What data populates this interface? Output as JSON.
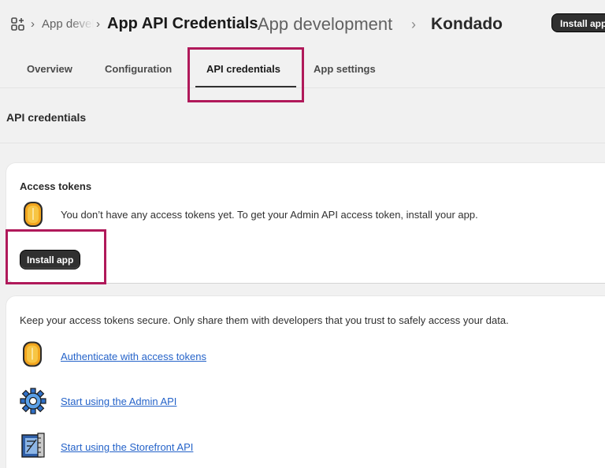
{
  "header": {
    "crumb_small": "App development",
    "crumb_bold": "App API Credentials",
    "crumb_light": "App development",
    "shop": "Kondado",
    "install_label": "Install app"
  },
  "tabs": [
    {
      "label": "Overview"
    },
    {
      "label": "Configuration"
    },
    {
      "label": "API credentials"
    },
    {
      "label": "App settings"
    }
  ],
  "section": {
    "title": "API credentials"
  },
  "access_tokens": {
    "title": "Access tokens",
    "message": "You don’t have any access tokens yet. To get your Admin API access token, install your app.",
    "install_label": "Install app"
  },
  "security": {
    "message": "Keep your access tokens secure. Only share them with developers that you trust to safely access your data.",
    "links": [
      {
        "label": "Authenticate with access tokens",
        "icon": "coin-icon"
      },
      {
        "label": "Start using the Admin API",
        "icon": "gear-icon"
      },
      {
        "label": "Start using the Storefront API",
        "icon": "blueprint-icon"
      }
    ]
  },
  "colors": {
    "highlight": "#b0195a",
    "link": "#2563c9",
    "button": "#303030"
  }
}
